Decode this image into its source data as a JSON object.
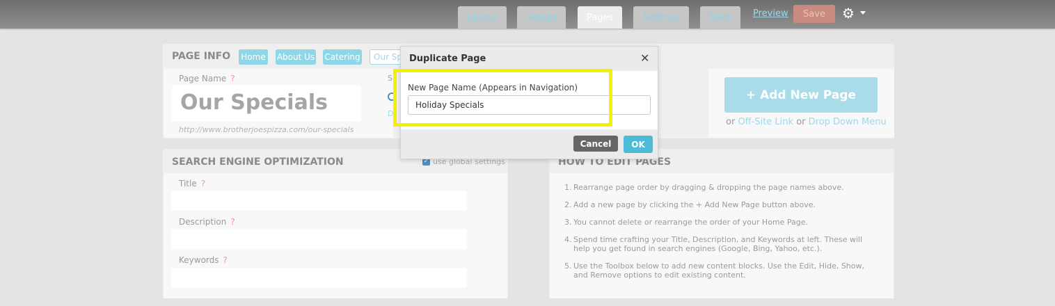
{
  "topbar": {
    "tabs": [
      {
        "label": "Layout",
        "active": false
      },
      {
        "label": "Design",
        "active": false
      },
      {
        "label": "Pages",
        "active": true
      },
      {
        "label": "Settings",
        "active": false
      },
      {
        "label": "Stats",
        "active": false
      }
    ],
    "preview_label": "Preview",
    "save_label": "Save",
    "settings_icon": "gear-icon"
  },
  "page_info": {
    "heading": "PAGE INFO",
    "page_tabs": [
      "Home",
      "About Us",
      "Catering",
      "Our Sp"
    ],
    "page_name_label": "Page Name",
    "help_mark": "?",
    "page_name_value": "Our Specials",
    "url": "http://www.brotherjoespizza.com/our-specials",
    "clipped_label_s": "S",
    "clipped_label_d": "D"
  },
  "add_page": {
    "button_label": "+ Add New Page",
    "or1": "or",
    "offsite_link": "Off-Site Link",
    "or2": "or",
    "dropdown_link": "Drop Down Menu"
  },
  "seo": {
    "heading": "SEARCH ENGINE OPTIMIZATION",
    "use_global_label": "use global settings",
    "use_global_checked": true,
    "fields": [
      {
        "label": "Title",
        "value": ""
      },
      {
        "label": "Description",
        "value": ""
      },
      {
        "label": "Keywords",
        "value": ""
      }
    ]
  },
  "howto": {
    "heading": "HOW TO EDIT PAGES",
    "steps": [
      {
        "num": "1.",
        "text": "Rearrange page order by dragging & dropping the page names above."
      },
      {
        "num": "2.",
        "text": "Add a new page by clicking the + Add New Page button above."
      },
      {
        "num": "3.",
        "text": "You cannot delete or rearrange the order of your Home Page."
      },
      {
        "num": "4.",
        "text": "Spend time crafting your Title, Description, and Keywords at left. These will help you get found in search engines (Google, Bing, Yahoo, etc.)."
      },
      {
        "num": "5.",
        "text": "Use the Toolbox below to add new content blocks. Use the Edit, Hide, Show, and Remove options to edit existing content."
      }
    ]
  },
  "dialog": {
    "title": "Duplicate Page",
    "close_glyph": "✕",
    "field_label": "New Page Name (Appears in Navigation)",
    "field_value": "Holiday Specials",
    "cancel_label": "Cancel",
    "ok_label": "OK",
    "highlight_color": "#f2f200"
  },
  "colors": {
    "accent": "#8fd6e6",
    "ok_button": "#4fbad5",
    "cancel_button": "#666666",
    "save_button": "#c98b80",
    "help_mark": "#f08fb4"
  }
}
